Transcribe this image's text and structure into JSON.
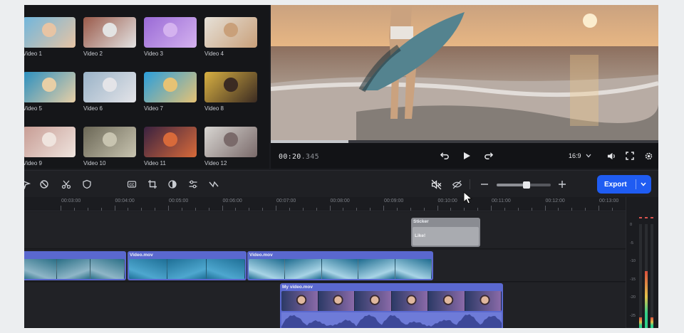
{
  "library": {
    "videos": [
      {
        "label": "Video 1",
        "colors": [
          "#6fb6dd",
          "#e7c4a4"
        ]
      },
      {
        "label": "Video 2",
        "colors": [
          "#9a5a4a",
          "#e3e3e3"
        ]
      },
      {
        "label": "Video 3",
        "colors": [
          "#9a6ad6",
          "#d4b2ef"
        ]
      },
      {
        "label": "Video 4",
        "colors": [
          "#e6e1d8",
          "#c9a07a"
        ]
      },
      {
        "label": "Video 5",
        "colors": [
          "#2a8fc0",
          "#e8cfa6"
        ]
      },
      {
        "label": "Video 6",
        "colors": [
          "#9ab3c8",
          "#e4e4e8"
        ]
      },
      {
        "label": "Video 7",
        "colors": [
          "#2a9edc",
          "#e6c274"
        ]
      },
      {
        "label": "Video 8",
        "colors": [
          "#d8b042",
          "#3b2b22"
        ]
      },
      {
        "label": "Video 9",
        "colors": [
          "#c79c94",
          "#efe4de"
        ]
      },
      {
        "label": "Video 10",
        "colors": [
          "#6b6756",
          "#c8c4b0"
        ]
      },
      {
        "label": "Video 11",
        "colors": [
          "#3a2240",
          "#d86a3a"
        ]
      },
      {
        "label": "Video 12",
        "colors": [
          "#d8d6d2",
          "#7a6a6a"
        ]
      }
    ]
  },
  "player": {
    "timecode_main": "00:20",
    "timecode_ms": ".345",
    "progress": 0.2,
    "aspect_ratio": "16:9",
    "icons": [
      "undo-icon",
      "play-icon",
      "redo-icon",
      "chevron-down-icon",
      "volume-icon",
      "fullscreen-icon",
      "gear-icon"
    ]
  },
  "toolbar": {
    "tools": [
      "select-icon",
      "disable-icon",
      "scissors-icon",
      "shield-icon",
      "captions-icon",
      "crop-icon",
      "color-icon",
      "adjust-icon",
      "transition-icon",
      "unlink-audio-icon",
      "hide-icon",
      "zoom-out-icon",
      "zoom-in-icon"
    ],
    "captions_text": "CC",
    "zoom_level": 0.55,
    "export_label": "Export"
  },
  "ruler": {
    "labels": [
      "00:03:00",
      "00:04:00",
      "00:05:00",
      "00:06:00",
      "00:07:00",
      "00:08:00",
      "00:09:00",
      "00:10:00",
      "00:11:00",
      "00:12:00",
      "00:13:00"
    ]
  },
  "timeline": {
    "sticker_clip": {
      "name": "Sticker",
      "text": "Like!"
    },
    "video_clips": [
      {
        "name": "",
        "colors": [
          "#2a6f86",
          "#8fb6c7"
        ]
      },
      {
        "name": "Video.mov",
        "colors": [
          "#1e6f96",
          "#4ea7cf"
        ]
      },
      {
        "name": "Video.mov",
        "colors": [
          "#1d6b8f",
          "#a8d4e6"
        ]
      }
    ],
    "my_video_clip": {
      "name": "My video.mov"
    }
  },
  "meters": {
    "scale": [
      "0",
      "-5",
      "-10",
      "-15",
      "-20",
      "-25",
      "-30"
    ],
    "levels": [
      0.1,
      0.55,
      0.1
    ]
  },
  "colors": {
    "accent": "#1f5cf2",
    "clip": "#5a68cf",
    "sticker": "#8a8c92"
  }
}
